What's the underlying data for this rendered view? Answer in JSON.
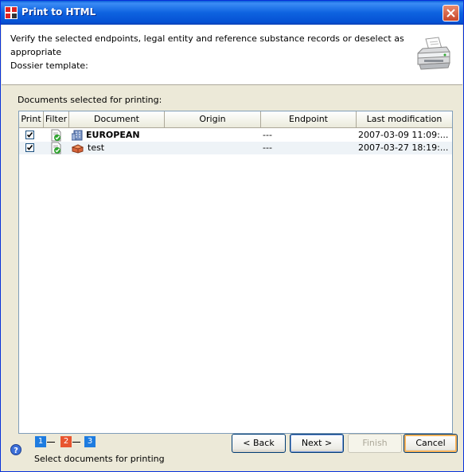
{
  "window": {
    "title": "Print to HTML",
    "app_icon": "iuclid-app-icon",
    "close_icon": "close-icon"
  },
  "header": {
    "line1": "Verify the selected endpoints, legal entity and reference substance records or deselect as",
    "line2": "appropriate",
    "line3": "Dossier template:",
    "icon": "printer-icon"
  },
  "main": {
    "docs_label": "Documents selected for printing:",
    "columns": [
      "Print",
      "Filter",
      "Document",
      "Origin",
      "Endpoint",
      "Last modification"
    ],
    "rows": [
      {
        "print_checked": true,
        "filter_icon": "filter-ok-icon",
        "doc_icon": "legal-entity-icon",
        "document": "EUROPEAN",
        "origin": "",
        "endpoint": "---",
        "last_modification": "2007-03-09 11:09:..."
      },
      {
        "print_checked": true,
        "filter_icon": "filter-ok-icon",
        "doc_icon": "substance-icon",
        "document": "test",
        "origin": "",
        "endpoint": "---",
        "last_modification": "2007-03-27 18:19:..."
      }
    ]
  },
  "footer": {
    "steps": [
      "1",
      "2",
      "3"
    ],
    "current_step": 2,
    "step_caption": "Select documents for printing",
    "buttons": {
      "back": "< Back",
      "next": "Next >",
      "finish": "Finish",
      "cancel": "Cancel"
    },
    "help_icon": "help-icon"
  },
  "colors": {
    "title_bar": "#0e63e0",
    "step_active": "#e8552f",
    "step_inactive": "#1e7ce0"
  }
}
